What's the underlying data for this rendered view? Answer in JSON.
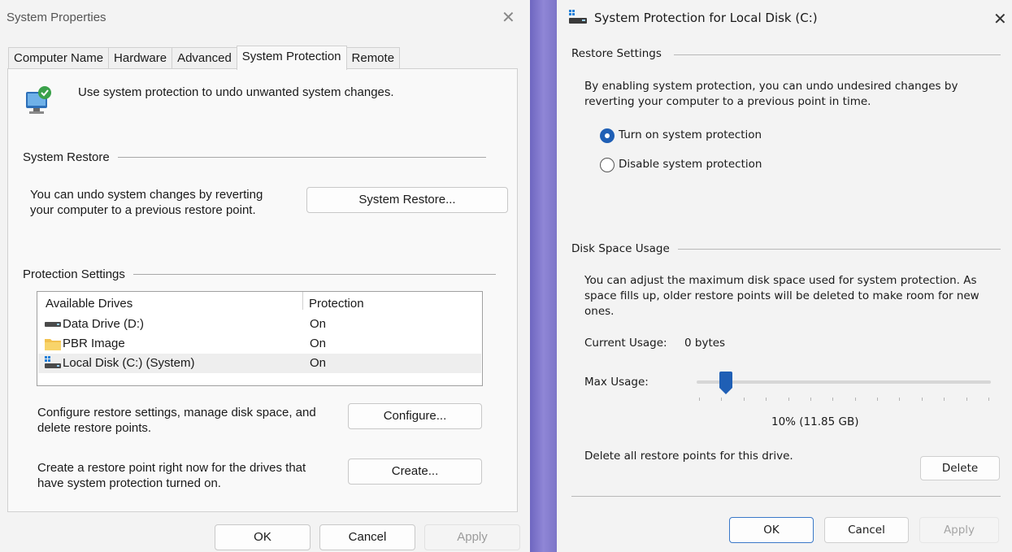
{
  "left": {
    "title": "System Properties",
    "tabs": [
      "Computer Name",
      "Hardware",
      "Advanced",
      "System Protection",
      "Remote"
    ],
    "intro": "Use system protection to undo unwanted system changes.",
    "system_restore": {
      "group_label": "System Restore",
      "description_line1": "You can undo system changes by reverting",
      "description_line2": "your computer to a previous restore point.",
      "button": "System Restore..."
    },
    "protection": {
      "group_label": "Protection Settings",
      "columns": [
        "Available Drives",
        "Protection"
      ],
      "drives": [
        {
          "name": "Data Drive (D:)",
          "protection": "On",
          "icon": "drive-icon"
        },
        {
          "name": "PBR Image",
          "protection": "On",
          "icon": "folder-icon"
        },
        {
          "name": "Local Disk (C:) (System)",
          "protection": "On",
          "icon": "system-drive-icon"
        }
      ],
      "configure_desc_line1": "Configure restore settings, manage disk space, and",
      "configure_desc_line2": "delete restore points.",
      "configure_button": "Configure...",
      "create_desc_line1": "Create a restore point right now for the drives that",
      "create_desc_line2": "have system protection turned on.",
      "create_button": "Create..."
    },
    "footer": {
      "ok": "OK",
      "cancel": "Cancel",
      "apply": "Apply"
    }
  },
  "right": {
    "title": "System Protection for Local Disk (C:)",
    "restore_settings": {
      "group_label": "Restore Settings",
      "description_line1": "By enabling system protection, you can undo undesired changes by",
      "description_line2": "reverting your computer to a previous point in time.",
      "options": [
        "Turn on system protection",
        "Disable system protection"
      ],
      "selected": "Turn on system protection"
    },
    "disk_usage": {
      "group_label": "Disk Space Usage",
      "description_line1": "You can adjust the maximum disk space used for system protection. As",
      "description_line2": "space fills up, older restore points will be deleted to make room for new",
      "description_line3": "ones.",
      "current_usage_label": "Current Usage:",
      "current_usage_value": "0 bytes",
      "max_usage_label": "Max Usage:",
      "max_usage_percent": 10,
      "max_usage_text": "10% (11.85 GB)",
      "delete_desc": "Delete all restore points for this drive.",
      "delete_button": "Delete"
    },
    "footer": {
      "ok": "OK",
      "cancel": "Cancel",
      "apply": "Apply"
    }
  },
  "colors": {
    "accent": "#1f5fb5",
    "divider": "#8f86d6",
    "background": "#f3f3f3"
  }
}
